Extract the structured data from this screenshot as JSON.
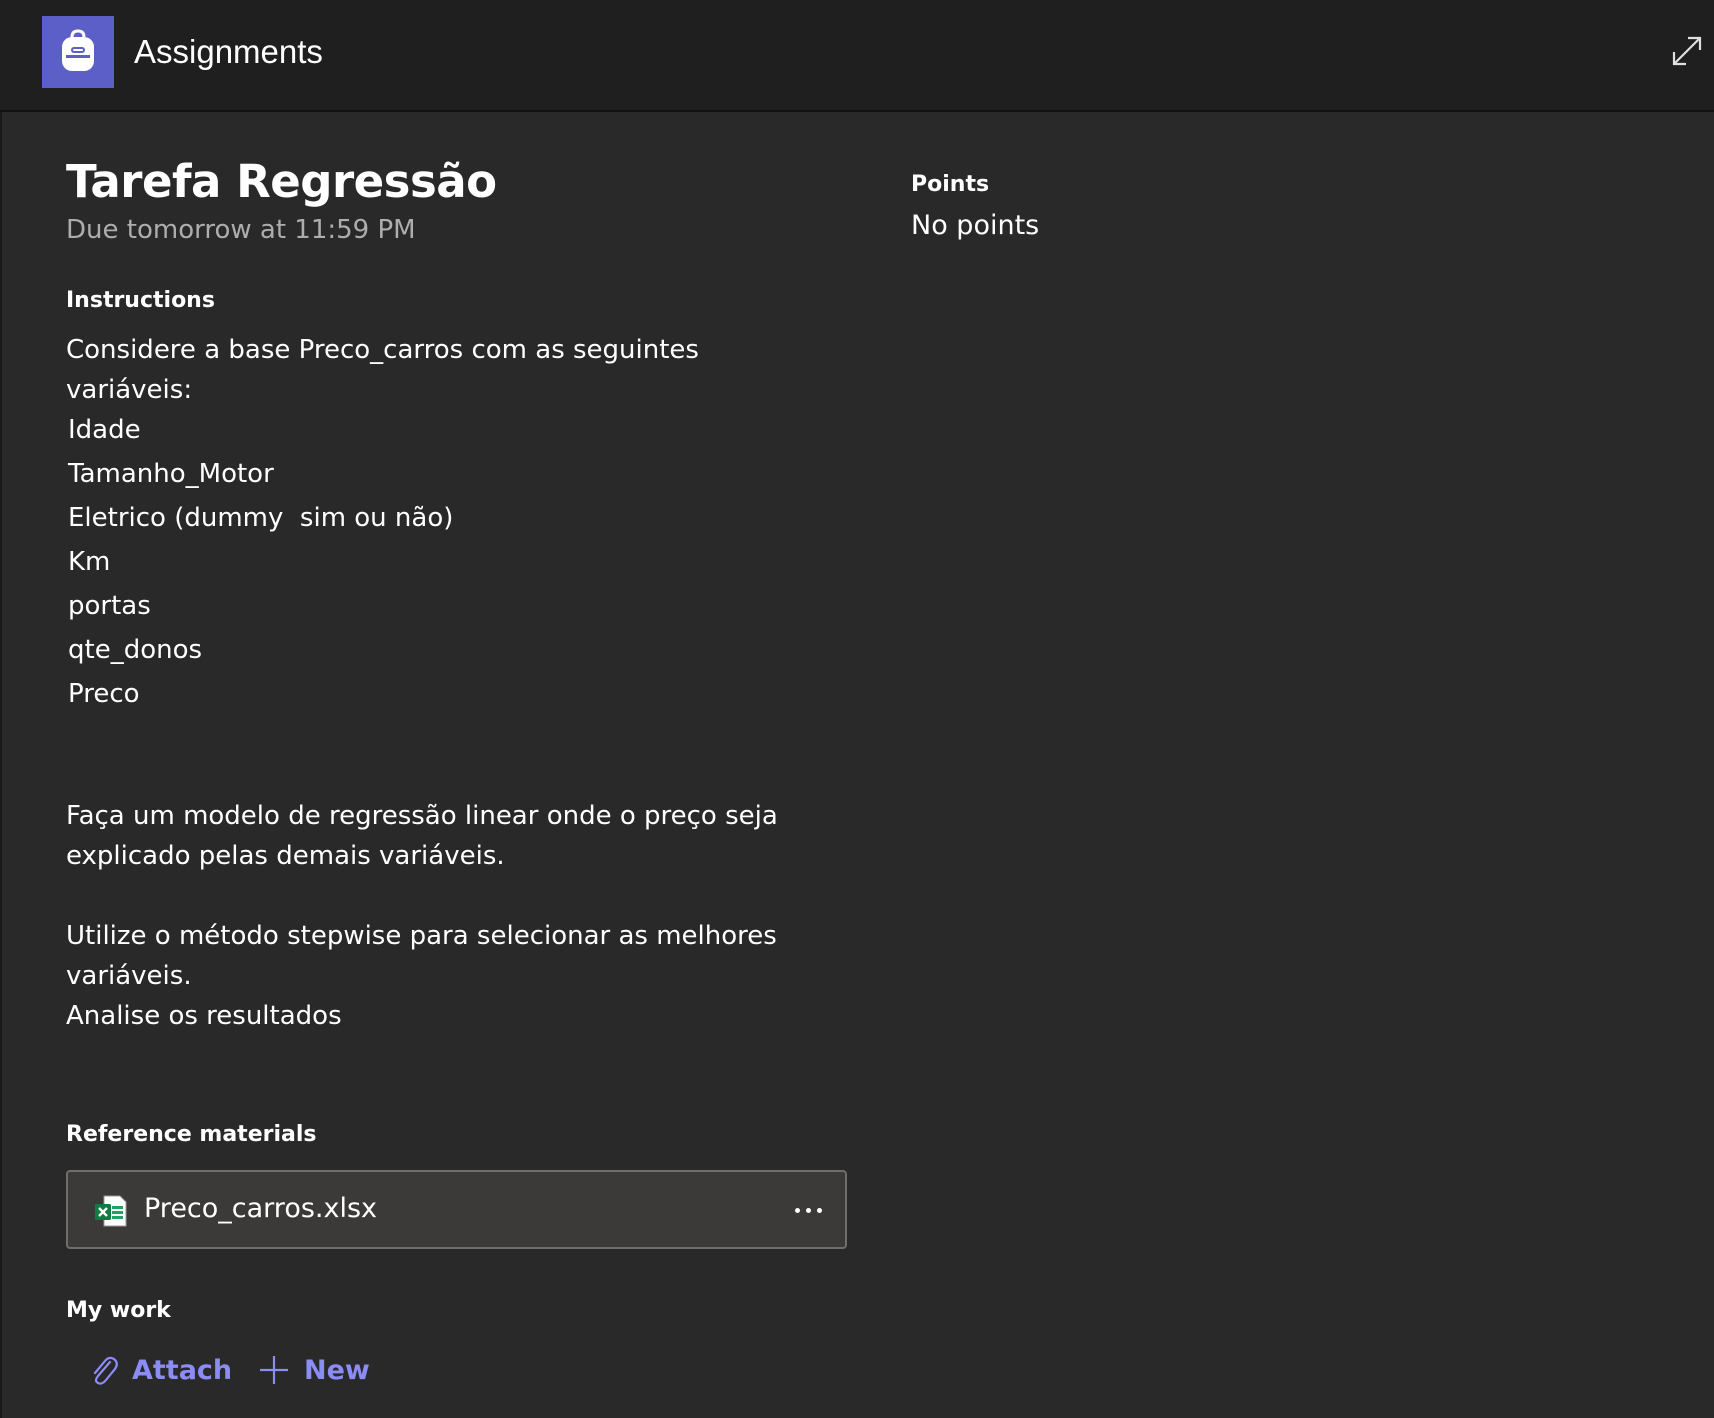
{
  "header": {
    "app_title": "Assignments",
    "app_icon": "backpack-icon",
    "expand_icon": "expand-icon",
    "accent_color": "#5b5fc7"
  },
  "assignment": {
    "title": "Tarefa Regressão",
    "due": "Due tomorrow at 11:59 PM",
    "points_label": "Points",
    "points_value": "No points"
  },
  "instructions": {
    "label": "Instructions",
    "intro": "Considere a base Preco_carros com as seguintes variáveis:",
    "variables": [
      "Idade",
      "Tamanho_Motor",
      "Eletrico (dummy  sim ou não)",
      "Km",
      "portas",
      "qte_donos",
      "Preco"
    ],
    "paragraph1": "Faça um modelo de regressão linear onde o preço seja explicado pelas demais variáveis.",
    "paragraph2_line1": "Utilize o método stepwise para selecionar as melhores variáveis.",
    "paragraph2_line2": "Analise os resultados"
  },
  "reference": {
    "label": "Reference materials",
    "file_name": "Preco_carros.xlsx",
    "file_icon": "excel-file-icon",
    "more_icon": "more-options-icon"
  },
  "my_work": {
    "label": "My work",
    "attach_label": "Attach",
    "new_label": "New",
    "link_color": "#8b8cf5"
  }
}
